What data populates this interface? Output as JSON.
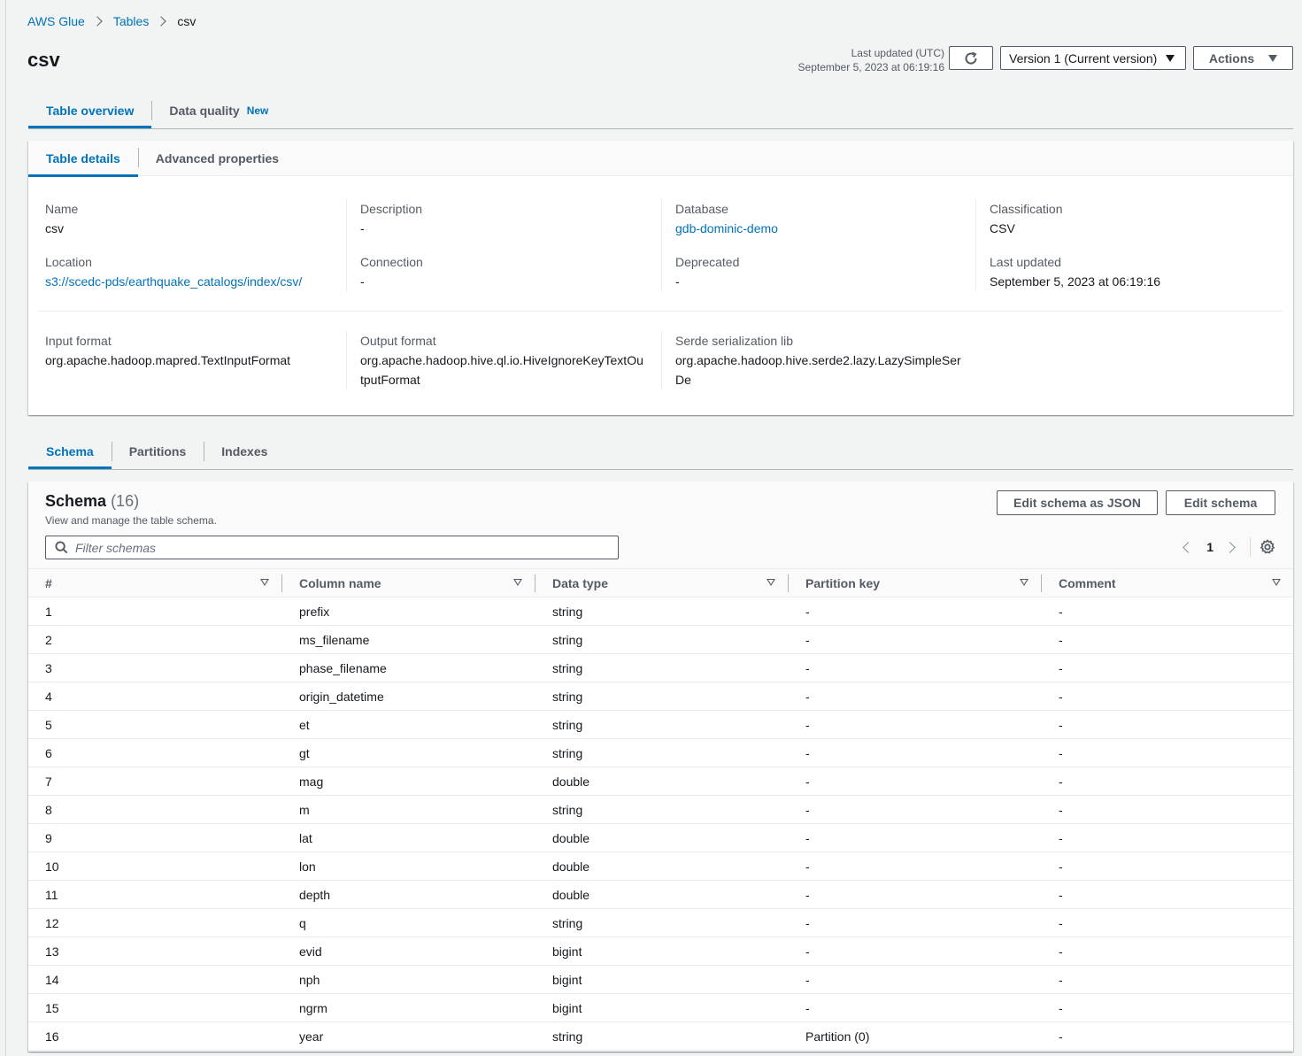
{
  "breadcrumb": {
    "items": [
      "AWS Glue",
      "Tables"
    ],
    "current": "csv"
  },
  "header": {
    "title": "csv",
    "last_updated_label": "Last updated (UTC)",
    "last_updated_value": "September 5, 2023 at 06:19:16",
    "version_label": "Version 1 (Current version)",
    "actions_label": "Actions"
  },
  "top_tabs": {
    "overview": "Table overview",
    "quality": "Data quality",
    "quality_badge": "New"
  },
  "detail_tabs": {
    "details": "Table details",
    "advanced": "Advanced properties"
  },
  "details": {
    "name_label": "Name",
    "name": "csv",
    "description_label": "Description",
    "description": "-",
    "database_label": "Database",
    "database": "gdb-dominic-demo",
    "classification_label": "Classification",
    "classification": "CSV",
    "location_label": "Location",
    "location": "s3://scedc-pds/earthquake_catalogs/index/csv/",
    "connection_label": "Connection",
    "connection": "-",
    "deprecated_label": "Deprecated",
    "deprecated": "-",
    "last_updated_label": "Last updated",
    "last_updated": "September 5, 2023 at 06:19:16",
    "input_format_label": "Input format",
    "input_format": "org.apache.hadoop.mapred.TextInputFormat",
    "output_format_label": "Output format",
    "output_format": "org.apache.hadoop.hive.ql.io.HiveIgnoreKeyTextOutputFormat",
    "serde_label": "Serde serialization lib",
    "serde": "org.apache.hadoop.hive.serde2.lazy.LazySimpleSerDe"
  },
  "schema_tabs": {
    "schema": "Schema",
    "partitions": "Partitions",
    "indexes": "Indexes"
  },
  "schema": {
    "title": "Schema",
    "count": "(16)",
    "description": "View and manage the table schema.",
    "edit_json_label": "Edit schema as JSON",
    "edit_label": "Edit schema",
    "filter_placeholder": "Filter schemas",
    "page": "1",
    "columns": [
      "#",
      "Column name",
      "Data type",
      "Partition key",
      "Comment"
    ],
    "rows": [
      [
        "1",
        "prefix",
        "string",
        "-",
        "-"
      ],
      [
        "2",
        "ms_filename",
        "string",
        "-",
        "-"
      ],
      [
        "3",
        "phase_filename",
        "string",
        "-",
        "-"
      ],
      [
        "4",
        "origin_datetime",
        "string",
        "-",
        "-"
      ],
      [
        "5",
        "et",
        "string",
        "-",
        "-"
      ],
      [
        "6",
        "gt",
        "string",
        "-",
        "-"
      ],
      [
        "7",
        "mag",
        "double",
        "-",
        "-"
      ],
      [
        "8",
        "m",
        "string",
        "-",
        "-"
      ],
      [
        "9",
        "lat",
        "double",
        "-",
        "-"
      ],
      [
        "10",
        "lon",
        "double",
        "-",
        "-"
      ],
      [
        "11",
        "depth",
        "double",
        "-",
        "-"
      ],
      [
        "12",
        "q",
        "string",
        "-",
        "-"
      ],
      [
        "13",
        "evid",
        "bigint",
        "-",
        "-"
      ],
      [
        "14",
        "nph",
        "bigint",
        "-",
        "-"
      ],
      [
        "15",
        "ngrm",
        "bigint",
        "-",
        "-"
      ],
      [
        "16",
        "year",
        "string",
        "Partition (0)",
        "-"
      ]
    ]
  }
}
